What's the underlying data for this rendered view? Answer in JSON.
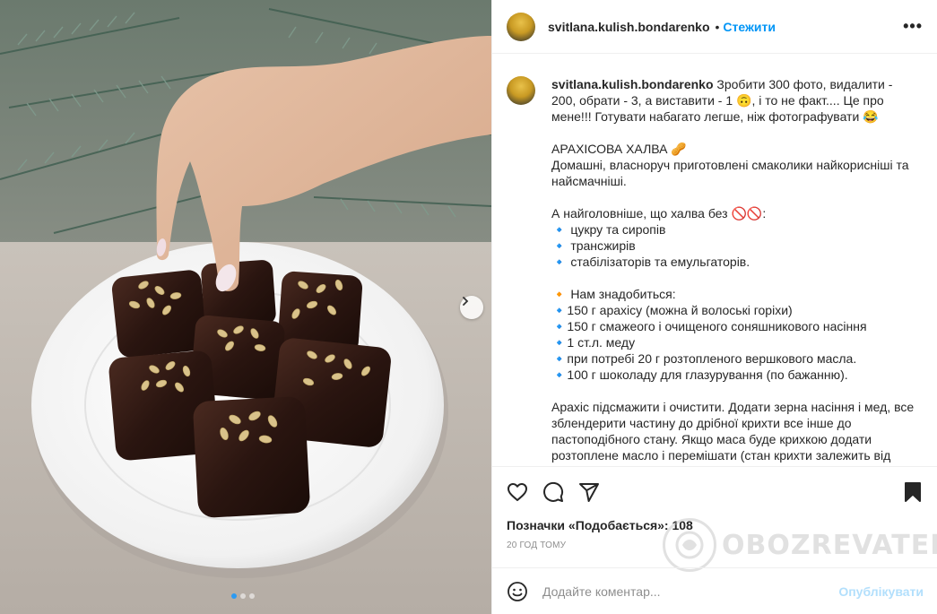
{
  "post": {
    "username": "svitlana.kulish.bondarenko",
    "separator": "•",
    "follow_label": "Стежити",
    "more_label": "•••",
    "caption_lines": [
      "Зробити 300 фото, видалити - 200, обрати - 3, а виставити - 1 🙃, і то не факт.... Це про мене!!! Готувати набагато легше, ніж фотографувати 😂",
      "",
      "АРАХІСОВА ХАЛВА 🥜",
      "Домашні, власноруч приготовлені смаколики найкорисніші та найсмачніші.",
      "",
      "А найголовніше, що халва без 🚫🚫:",
      "🔹 цукру та сиропів",
      "🔹 трансжирів",
      "🔹 стабілізаторів та емульгаторів.",
      "",
      "🔸 Нам знадобиться:",
      "🔹150 г арахісу (можна й волоські горіхи)",
      "🔹150 г смажеого і очищеного соняшникового насіння",
      "🔹1 ст.л. меду",
      "🔹при потребі 20 г розтопленого вершкового масла.",
      "🔹100 г шоколаду для глазурування (по бажанню).",
      "",
      "Арахіс підсмажити і очистити. Додати зерна насіння і мед, все зблендерити частину до дрібної крихти все інше до пастоподібного стану. Якщо маса буде крихкою додати розтоплене масло і перемішати (стан крихти залежить від"
    ],
    "likes_text": "Позначки «Подобається»: 108",
    "time_text": "20 ГОД ТОМУ",
    "comment_placeholder": "Додайте коментар...",
    "post_button_label": "Опублікувати",
    "watermark_text": "OBOZREVATEL"
  },
  "colors": {
    "link_blue": "#0095f6",
    "post_disabled": "#b2dffc",
    "muted": "#8e8e8e"
  },
  "icons": {
    "heart": "heart-icon",
    "comment": "comment-icon",
    "share": "share-icon",
    "bookmark": "bookmark-icon",
    "emoji": "emoji-icon",
    "next": "chevron-right-icon"
  },
  "carousel": {
    "slide_count": 3,
    "active_index": 0
  }
}
